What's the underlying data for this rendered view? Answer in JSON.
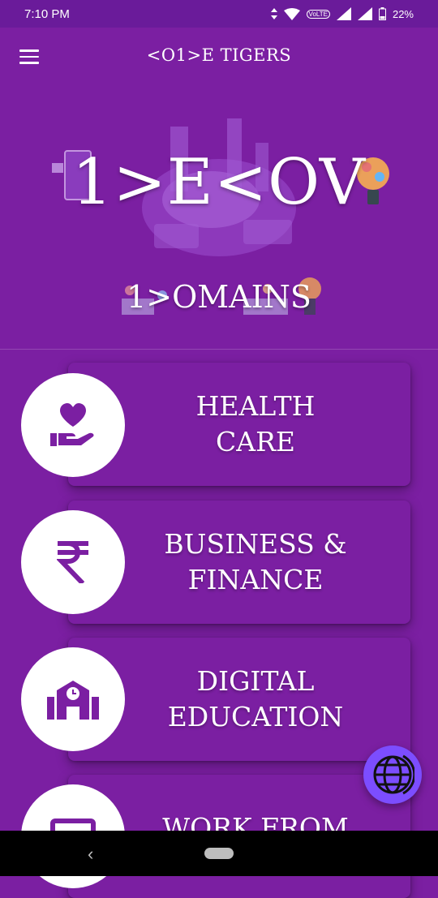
{
  "status_bar": {
    "time": "7:10 PM",
    "volte": "VoLTE",
    "battery": "22%"
  },
  "app_bar": {
    "title": "<O1>E TIGERS",
    "menu_icon": "hamburger-menu-icon"
  },
  "hero": {
    "title": "1>E<OV",
    "subtitle": "1>OMAINS"
  },
  "domains": [
    {
      "label": "HEALTH\nCARE",
      "icon": "heart-in-hand-icon"
    },
    {
      "label": "BUSINESS &\nFINANCE",
      "icon": "rupee-icon"
    },
    {
      "label": "DIGITAL\nEDUCATION",
      "icon": "school-icon"
    },
    {
      "label": "WORK FROM",
      "icon": "monitor-icon"
    }
  ],
  "fab": {
    "icon": "globe-icon"
  },
  "nav_bar": {
    "back_icon": "back-icon",
    "home_icon": "home-pill-icon"
  },
  "colors": {
    "background": "#7b1fa2",
    "status_bar": "#6a1b9a",
    "fab": "#7c4dff",
    "icon": "#7b1fa2"
  }
}
